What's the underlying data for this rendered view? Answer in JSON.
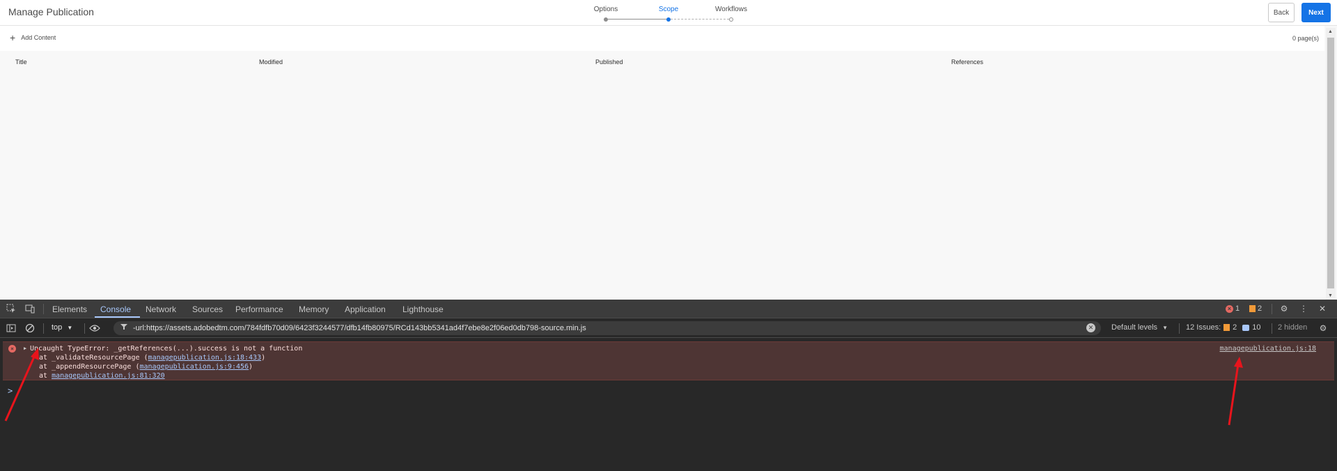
{
  "app": {
    "title": "Manage Publication",
    "wizard": {
      "steps": [
        "Options",
        "Scope",
        "Workflows"
      ],
      "active_index": 1
    },
    "back_label": "Back",
    "next_label": "Next",
    "add_content_label": "Add Content",
    "pages_count": "0 page(s)",
    "columns": [
      "Title",
      "Modified",
      "Published",
      "References"
    ]
  },
  "devtools": {
    "tabs": [
      "Elements",
      "Console",
      "Network",
      "Sources",
      "Performance",
      "Memory",
      "Application",
      "Lighthouse"
    ],
    "active_tab": "Console",
    "error_badge": "1",
    "warning_badge": "2",
    "context": "top",
    "filter_text": "-url:https://assets.adobedtm.com/784fdfb70d09/6423f3244577/dfb14fb80975/RCd143bb5341ad4f7ebe8e2f06ed0db798-source.min.js",
    "default_levels": "Default levels",
    "issues_label": "12 Issues:",
    "issues_warn_count": "2",
    "issues_msg_count": "10",
    "hidden_label": "2 hidden",
    "error": {
      "message": "Uncaught TypeError: _getReferences(...).success is not a function",
      "stack": [
        {
          "prefix": "at _validateResourcePage (",
          "link": "managepublication.js:18:433",
          "suffix": ")"
        },
        {
          "prefix": "at _appendResourcePage (",
          "link": "managepublication.js:9:456",
          "suffix": ")"
        },
        {
          "prefix": "at ",
          "link": "managepublication.js:81:320",
          "suffix": ""
        }
      ],
      "source": "managepublication.js:18"
    },
    "prompt_symbol": ">"
  },
  "colors": {
    "accent": "#1473e6",
    "annotation_arrow": "#e8141c",
    "devtools_bg": "#282828",
    "error_row_bg": "#4e3534"
  }
}
